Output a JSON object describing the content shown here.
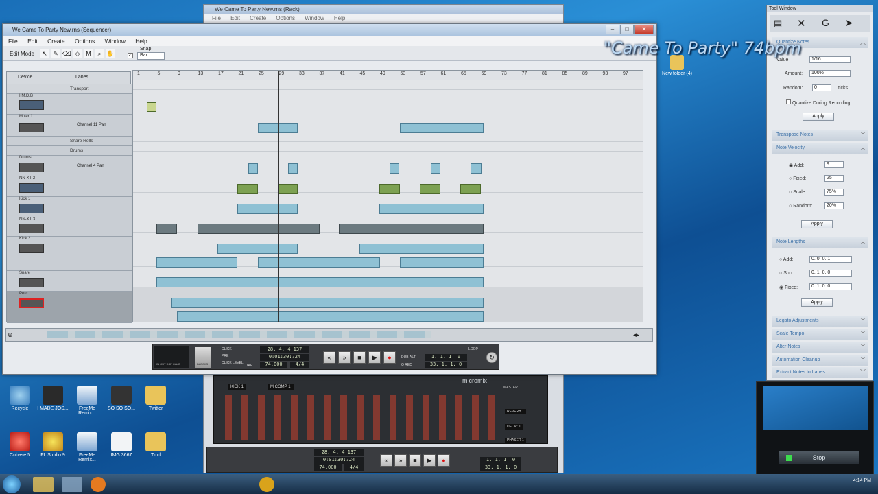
{
  "banner": {
    "text": "\"Came To Party\" 74bpm"
  },
  "rack_window": {
    "title": "We Came To Party New.rns (Rack)",
    "menu": [
      "File",
      "Edit",
      "Create",
      "Options",
      "Window",
      "Help"
    ]
  },
  "sequencer_window": {
    "title": "We Came To Party New.rns (Sequencer)",
    "menu": [
      "File",
      "Edit",
      "Create",
      "Options",
      "Window",
      "Help"
    ],
    "edit_mode_label": "Edit Mode",
    "snap_label": "Snap",
    "snap_value": "Bar",
    "device_header": "Device",
    "lanes_header": "Lanes",
    "ruler": [
      "1",
      "5",
      "9",
      "13",
      "17",
      "21",
      "25",
      "29",
      "33",
      "37",
      "41",
      "45",
      "49",
      "53",
      "57",
      "61",
      "65",
      "69",
      "73",
      "77",
      "81",
      "85",
      "89",
      "93",
      "97"
    ],
    "tracks": [
      {
        "label": "Transport"
      },
      {
        "label": "I.M.D.B"
      },
      {
        "label": "Mixer 1",
        "lane": "Channel 11 Pan"
      },
      {
        "label": "Snare Rolls"
      },
      {
        "label": "Drums"
      },
      {
        "label": "Drums",
        "lane": "Channel 4 Pan"
      },
      {
        "label": "NN-XT 2"
      },
      {
        "label": "Kick 1"
      },
      {
        "label": "NN-XT 3"
      },
      {
        "label": "Kick 2"
      },
      {
        "label": "Snare"
      },
      {
        "label": "Perc"
      }
    ]
  },
  "transport": {
    "position": "28. 4. 4.137",
    "time": "0:01:30:724",
    "tempo": "74.000",
    "signature": "4/4",
    "loop_left": "1. 1. 1.   0",
    "loop_right": "33. 1. 1.   0",
    "click_label": "CLICK",
    "pre_label": "PRE",
    "blocks_label": "BLOCKS",
    "dub_label": "DUB",
    "alt_label": "ALT",
    "q_rec_label": "Q REC",
    "loop_label": "LOOP",
    "tap_label": "TAP",
    "in_out_label": "IN  OUT  DSP  CALC",
    "click_level_label": "CLICK LEVEL"
  },
  "rack_transport": {
    "position": "28. 4. 4.137",
    "time": "0:01:30:724",
    "tempo": "74.000",
    "signature": "4/4",
    "loop_left": "1. 1. 1.   0",
    "loop_right": "33. 1. 1.   0",
    "mixer_name": "micromix",
    "channel_labels": [
      "KICK 1",
      "M COMP 1"
    ],
    "send_labels": [
      "REVERB 1",
      "DELAY 1",
      "PHASER 1"
    ],
    "master_label": "MASTER"
  },
  "tool_window": {
    "title": "Tool Window",
    "sections": {
      "quantize": {
        "title": "Quantize Notes",
        "value_label": "Value",
        "value": "1/16",
        "amount_label": "Amount:",
        "amount": "100%",
        "random_label": "Random:",
        "random": "0",
        "random_unit": "ticks",
        "during_rec": "Quantize During Recording",
        "apply": "Apply"
      },
      "transpose": {
        "title": "Transpose Notes"
      },
      "velocity": {
        "title": "Note Velocity",
        "add_label": "Add:",
        "add": "9",
        "fixed_label": "Fixed:",
        "fixed": "25",
        "scale_label": "Scale:",
        "scale": "75%",
        "random_label": "Random:",
        "random": "20%",
        "apply": "Apply"
      },
      "lengths": {
        "title": "Note Lengths",
        "add_label": "Add:",
        "add": "0. 0. 0.   1",
        "sub_label": "Sub:",
        "sub": "0. 1. 0.   0",
        "fixed_label": "Fixed:",
        "fixed": "0. 1. 0.   0",
        "apply": "Apply"
      },
      "others": [
        "Legato Adjustments",
        "Scale Tempo",
        "Alter Notes",
        "Automation Cleanup",
        "Extract Notes to Lanes"
      ]
    }
  },
  "desktop": {
    "icons": [
      {
        "label": "Recycle"
      },
      {
        "label": "I MADE JOS..."
      },
      {
        "label": "FreeMe Remix..."
      },
      {
        "label": "SO SO SO..."
      },
      {
        "label": "Twitter"
      },
      {
        "label": "Cubase 5"
      },
      {
        "label": "FL Studio 9"
      },
      {
        "label": "FreeMe Remix..."
      },
      {
        "label": "IMG 3667"
      },
      {
        "label": "Tmd"
      }
    ],
    "folder": {
      "label": "New folder (4)"
    }
  },
  "preview": {
    "stop_label": "Stop"
  },
  "taskbar": {
    "time": "4:14 PM"
  },
  "colors": {
    "clip_blue": "#8fc1d4",
    "clip_green": "#7da152",
    "clip_dark": "#6c7a80",
    "desktop_blue": "#1a6fb8",
    "section_title": "#3a6fa6"
  }
}
